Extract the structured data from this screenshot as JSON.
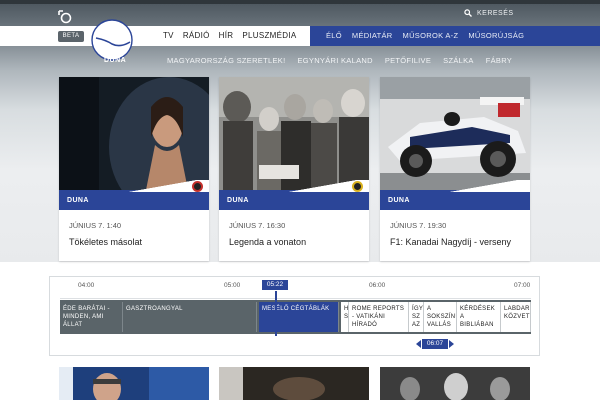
{
  "header": {
    "search_label": "KERESÉS",
    "beta_label": "BETA",
    "channel_name": "DUNA",
    "main_nav": [
      "TV",
      "RÁDIÓ",
      "HÍR",
      "PLUSZMÉDIA"
    ],
    "right_nav": [
      "ÉLŐ",
      "MÉDIATÁR",
      "MŰSOROK A-Z",
      "MŰSORÚJSÁG"
    ],
    "sub_nav": [
      "MAGYARORSZÁG SZERETLEK!",
      "EGYNYÁRI KALAND",
      "PETŐFILIVE",
      "SZÁLKA",
      "FÁBRY"
    ]
  },
  "cards": [
    {
      "channel": "DUNA",
      "time": "JÚNIUS 7. 1:40",
      "title": "Tökéletes másolat",
      "badge": "red"
    },
    {
      "channel": "DUNA",
      "time": "JÚNIUS 7. 16:30",
      "title": "Legenda a vonaton",
      "badge": "yellow"
    },
    {
      "channel": "DUNA",
      "time": "JÚNIUS 7. 19:30",
      "title": "F1: Kanadai Nagydíj - verseny",
      "badge": ""
    }
  ],
  "timeline": {
    "ticks": [
      "04:00",
      "05:00",
      "06:00",
      "07:00"
    ],
    "now_label": "05:22",
    "marker_label": "06:07",
    "programs": [
      {
        "label": "ÉDE BARÁTAI - MINDEN, AMI ÁLLAT",
        "style": "dark"
      },
      {
        "label": "GASZTROANGYAL",
        "style": "dark"
      },
      {
        "label": "MESÉLŐ CÉGTÁBLÁK",
        "style": "active"
      },
      {
        "label": "H SZ",
        "style": "light"
      },
      {
        "label": "ROME REPORTS - VATIKÁNI HÍRADÓ",
        "style": "light"
      },
      {
        "label": "ÍGY SZ AZ",
        "style": "light"
      },
      {
        "label": "A SOKSZÍNŰ VALLÁS",
        "style": "light"
      },
      {
        "label": "KÉRDÉSEK A BIBLIÁBAN",
        "style": "light"
      },
      {
        "label": "LABDARÚG KÖZVETÍT",
        "style": "light"
      }
    ]
  },
  "colors": {
    "accent_blue": "#2b4598",
    "badge_red": "#c4302b",
    "badge_yellow": "#d9b11e"
  }
}
